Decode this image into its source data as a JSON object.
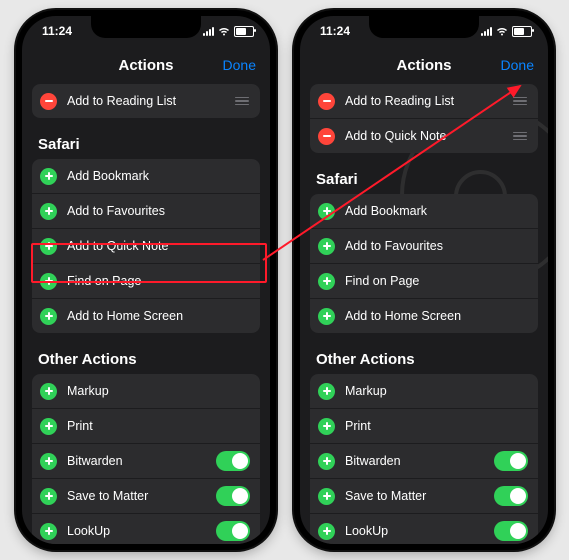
{
  "statusbar": {
    "time": "11:24"
  },
  "header": {
    "title": "Actions",
    "done": "Done"
  },
  "left": {
    "included": [
      {
        "label": "Add to Reading List",
        "mode": "minus",
        "grip": true
      }
    ],
    "safari_title": "Safari",
    "safari": [
      {
        "label": "Add Bookmark"
      },
      {
        "label": "Add to Favourites"
      },
      {
        "label": "Add to Quick Note"
      },
      {
        "label": "Find on Page"
      },
      {
        "label": "Add to Home Screen"
      }
    ],
    "other_title": "Other Actions",
    "other": [
      {
        "label": "Markup",
        "toggle": false
      },
      {
        "label": "Print",
        "toggle": false
      },
      {
        "label": "Bitwarden",
        "toggle": true
      },
      {
        "label": "Save to Matter",
        "toggle": true
      },
      {
        "label": "LookUp",
        "toggle": true
      }
    ]
  },
  "right": {
    "included": [
      {
        "label": "Add to Reading List",
        "mode": "minus",
        "grip": true
      },
      {
        "label": "Add to Quick Note",
        "mode": "minus",
        "grip": true
      }
    ],
    "safari_title": "Safari",
    "safari": [
      {
        "label": "Add Bookmark"
      },
      {
        "label": "Add to Favourites"
      },
      {
        "label": "Find on Page"
      },
      {
        "label": "Add to Home Screen"
      }
    ],
    "other_title": "Other Actions",
    "other": [
      {
        "label": "Markup",
        "toggle": false
      },
      {
        "label": "Print",
        "toggle": false
      },
      {
        "label": "Bitwarden",
        "toggle": true
      },
      {
        "label": "Save to Matter",
        "toggle": true
      },
      {
        "label": "LookUp",
        "toggle": true
      }
    ]
  }
}
